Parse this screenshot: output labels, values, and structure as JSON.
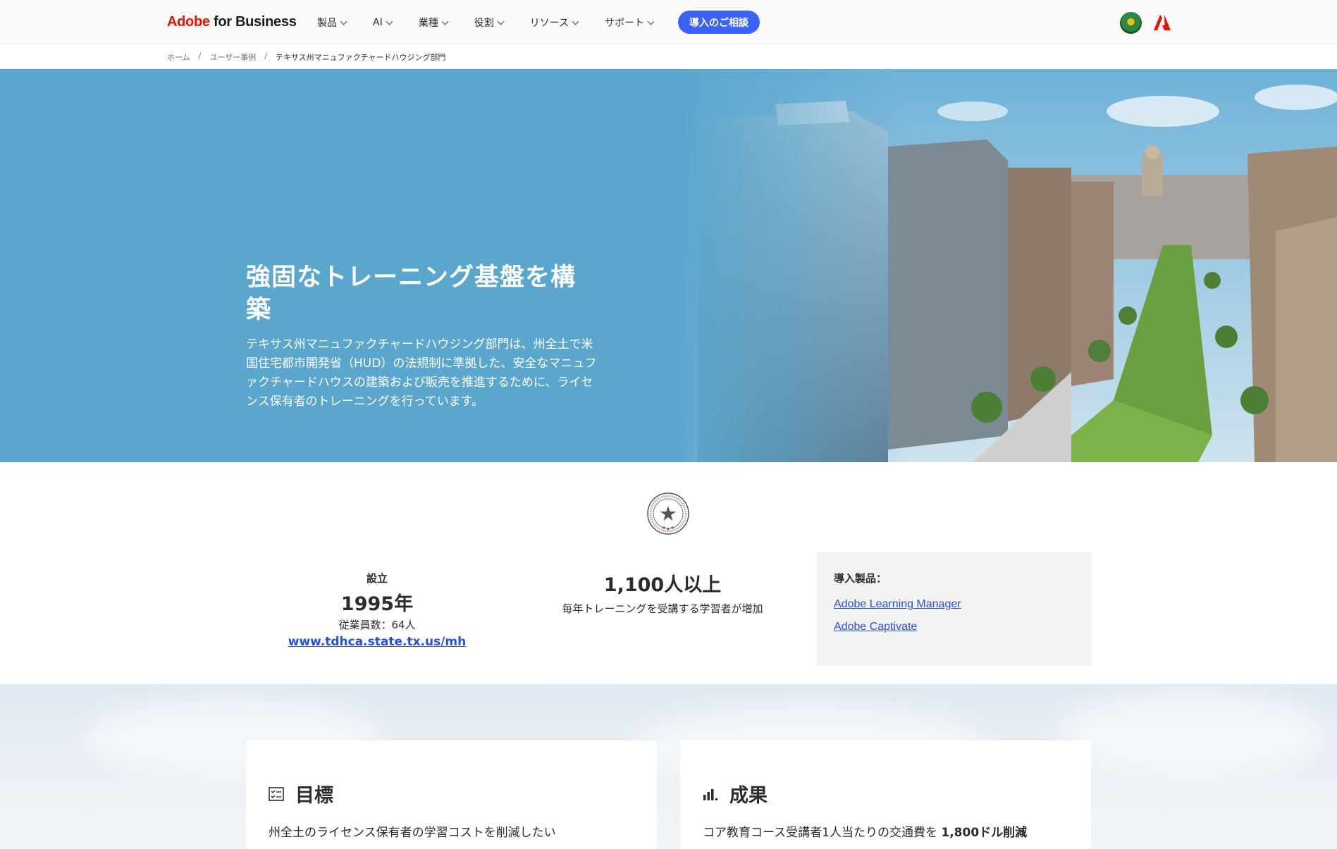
{
  "nav": {
    "brand_prefix": "Adobe",
    "brand_suffix": " for Business",
    "menu": [
      {
        "label": "製品"
      },
      {
        "label": "AI"
      },
      {
        "label": "業種"
      },
      {
        "label": "役割"
      },
      {
        "label": "リソース"
      },
      {
        "label": "サポート"
      }
    ],
    "cta": "導入のご相談"
  },
  "breadcrumb": {
    "home": "ホーム",
    "sep": "/",
    "cases": "ユーザー事例",
    "current": "テキサス州マニュファクチャードハウジング部門"
  },
  "hero": {
    "title": "強固なトレーニング基盤を構築",
    "description": "テキサス州マニュファクチャードハウジング部門は、州全土で米国住宅都市開発省（HUD）の法規制に準拠した、安全なマニュファクチャードハウスの建築および販売を推進するために、ライセンス保有者のトレーニングを行っています。",
    "background_color": "#5aa6cc"
  },
  "stats": {
    "founded_label": "設立",
    "founded_year": "1995年",
    "employees": "従業員数：64人",
    "website": "www.tdhca.state.tx.us/mh",
    "learners_count": "1,100人以上",
    "learners_desc": "毎年トレーニングを受講する学習者が増加"
  },
  "products": {
    "title": "導入製品：",
    "items": [
      "Adobe Learning Manager",
      "Adobe Captivate"
    ]
  },
  "cards": {
    "goal_title": "目標",
    "goal_text": "州全土のライセンス保有者の学習コストを削減したい",
    "result_title": "成果",
    "result_text_prefix": "コア教育コース受講者1人当たりの交通費を ",
    "result_text_strong": "1,800ドル削減"
  },
  "colors": {
    "accent": "#3b63fb",
    "link": "#274dea",
    "adobe_red": "#eb1000"
  }
}
